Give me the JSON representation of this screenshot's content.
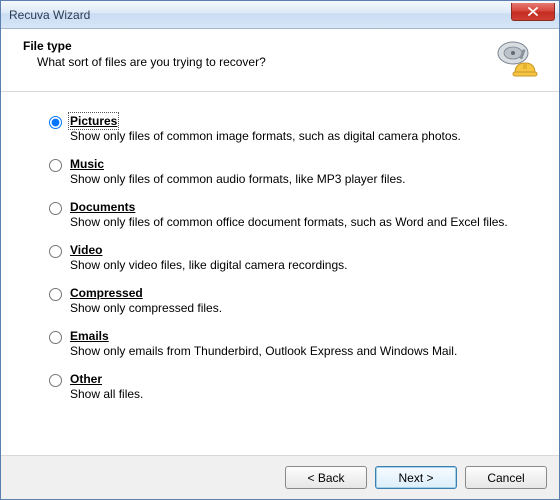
{
  "window": {
    "title": "Recuva Wizard"
  },
  "header": {
    "title": "File type",
    "subtitle": "What sort of files are you trying to recover?",
    "icon": "harddrive-hardhat-icon"
  },
  "options": [
    {
      "id": "pictures",
      "label": "Pictures",
      "desc": "Show only files of common image formats, such as digital camera photos.",
      "selected": true
    },
    {
      "id": "music",
      "label": "Music",
      "desc": "Show only files of common audio formats, like MP3 player files.",
      "selected": false
    },
    {
      "id": "documents",
      "label": "Documents",
      "desc": "Show only files of common office document formats, such as Word and Excel files.",
      "selected": false
    },
    {
      "id": "video",
      "label": "Video",
      "desc": "Show only video files, like digital camera recordings.",
      "selected": false
    },
    {
      "id": "compressed",
      "label": "Compressed",
      "desc": "Show only compressed files.",
      "selected": false
    },
    {
      "id": "emails",
      "label": "Emails",
      "desc": "Show only emails from Thunderbird, Outlook Express and Windows Mail.",
      "selected": false
    },
    {
      "id": "other",
      "label": "Other",
      "desc": "Show all files.",
      "selected": false
    }
  ],
  "footer": {
    "back": "< Back",
    "next": "Next >",
    "cancel": "Cancel"
  }
}
